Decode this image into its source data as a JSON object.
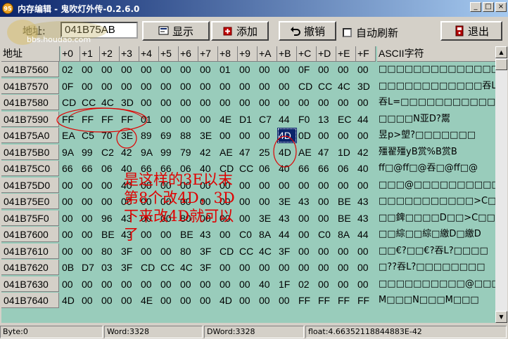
{
  "window": {
    "title": "内存编辑 - 鬼吹灯外传-0.2.6.0",
    "app_icon_text": "95",
    "minimize": "_",
    "maximize": "□",
    "close": "×"
  },
  "toolbar": {
    "address_label": "地址:",
    "address_value": "041B75AB",
    "watermark": "bbs.houdao.com",
    "show_label": "显示",
    "add_label": "添加",
    "undo_label": "撤销",
    "auto_refresh_label": "自动刷新",
    "auto_refresh_checked": false,
    "exit_label": "退出"
  },
  "grid": {
    "headers": [
      "地址",
      "+0",
      "+1",
      "+2",
      "+3",
      "+4",
      "+5",
      "+6",
      "+7",
      "+8",
      "+9",
      "+A",
      "+B",
      "+C",
      "+D",
      "+E",
      "+F",
      "ASCII字符"
    ],
    "rows": [
      {
        "addr": "041B7560",
        "bytes": [
          "02",
          "00",
          "00",
          "00",
          "00",
          "00",
          "00",
          "00",
          "01",
          "00",
          "00",
          "00",
          "0F",
          "00",
          "00",
          "00"
        ],
        "ascii": "□□□□□□□□□□□□□□□□"
      },
      {
        "addr": "041B7570",
        "bytes": [
          "0F",
          "00",
          "00",
          "00",
          "00",
          "00",
          "00",
          "00",
          "00",
          "00",
          "00",
          "00",
          "CD",
          "CC",
          "4C",
          "3D"
        ],
        "ascii": "□□□□□□□□□□□□吞L="
      },
      {
        "addr": "041B7580",
        "bytes": [
          "CD",
          "CC",
          "4C",
          "3D",
          "00",
          "00",
          "00",
          "00",
          "00",
          "00",
          "00",
          "00",
          "00",
          "00",
          "00",
          "00"
        ],
        "ascii": "吞L=□□□□□□□□□□□□"
      },
      {
        "addr": "041B7590",
        "bytes": [
          "FF",
          "FF",
          "FF",
          "FF",
          "01",
          "00",
          "00",
          "00",
          "4E",
          "D1",
          "C7",
          "44",
          "F0",
          "13",
          "EC",
          "44"
        ],
        "ascii": "□□□□N亚D?鬻"
      },
      {
        "addr": "041B75A0",
        "bytes": [
          "EA",
          "C5",
          "70",
          "3E",
          "89",
          "69",
          "88",
          "3E",
          "00",
          "00",
          "00",
          "4D",
          "0D",
          "00",
          "00",
          "00"
        ],
        "ascii": "昱p>塱?□□□□□□□"
      },
      {
        "addr": "041B75B0",
        "bytes": [
          "9A",
          "99",
          "C2",
          "42",
          "9A",
          "99",
          "79",
          "42",
          "AE",
          "47",
          "25",
          "4D",
          "AE",
          "47",
          "1D",
          "42"
        ],
        "ascii": "殭翟殭yB赏%B赏B"
      },
      {
        "addr": "041B75C0",
        "bytes": [
          "66",
          "66",
          "06",
          "40",
          "66",
          "66",
          "06",
          "40",
          "CD",
          "CC",
          "06",
          "40",
          "66",
          "66",
          "06",
          "40"
        ],
        "ascii": "ff□@ff□@吞□@ff□@"
      },
      {
        "addr": "041B75D0",
        "bytes": [
          "00",
          "00",
          "00",
          "40",
          "00",
          "00",
          "00",
          "00",
          "00",
          "00",
          "00",
          "00",
          "00",
          "00",
          "00",
          "00"
        ],
        "ascii": "□□□@□□□□□□□□□□□□"
      },
      {
        "addr": "041B75E0",
        "bytes": [
          "00",
          "00",
          "00",
          "00",
          "00",
          "00",
          "00",
          "00",
          "00",
          "00",
          "00",
          "3E",
          "43",
          "00",
          "BE",
          "43"
        ],
        "ascii": "□□□□□□□□□□□>C□□綜"
      },
      {
        "addr": "041B75F0",
        "bytes": [
          "00",
          "00",
          "96",
          "43",
          "00",
          "00",
          "80",
          "00",
          "00",
          "00",
          "3E",
          "43",
          "00",
          "00",
          "BE",
          "43"
        ],
        "ascii": "□□錍□□□□D□□>C□□綜"
      },
      {
        "addr": "041B7600",
        "bytes": [
          "00",
          "00",
          "BE",
          "43",
          "00",
          "00",
          "BE",
          "43",
          "00",
          "C0",
          "8A",
          "44",
          "00",
          "C0",
          "8A",
          "44"
        ],
        "ascii": "□□綜□□綜□繳D□繳D"
      },
      {
        "addr": "041B7610",
        "bytes": [
          "00",
          "00",
          "80",
          "3F",
          "00",
          "00",
          "80",
          "3F",
          "CD",
          "CC",
          "4C",
          "3F",
          "00",
          "00",
          "00",
          "00"
        ],
        "ascii": "□□€?□□€?吞L?□□□□"
      },
      {
        "addr": "041B7620",
        "bytes": [
          "0B",
          "D7",
          "03",
          "3F",
          "CD",
          "CC",
          "4C",
          "3F",
          "00",
          "00",
          "00",
          "00",
          "00",
          "00",
          "00",
          "00"
        ],
        "ascii": "□??吞L?□□□□□□□□"
      },
      {
        "addr": "041B7630",
        "bytes": [
          "00",
          "00",
          "00",
          "00",
          "00",
          "00",
          "00",
          "00",
          "00",
          "00",
          "40",
          "1F",
          "02",
          "00",
          "00",
          "00"
        ],
        "ascii": "□□□□□□□□□□@□□□□□"
      },
      {
        "addr": "041B7640",
        "bytes": [
          "4D",
          "00",
          "00",
          "00",
          "4E",
          "00",
          "00",
          "00",
          "4D",
          "00",
          "00",
          "00",
          "FF",
          "FF",
          "FF",
          "FF"
        ],
        "ascii": "M□□□N□□□M□□□"
      }
    ]
  },
  "annotation": {
    "line1": "是这样的3E以末",
    "line2": "第8个改4D，3D",
    "line3": "下来改4D就可以",
    "line4": "了",
    "color": "#e00000"
  },
  "status": {
    "byte": "Byte:0",
    "word": "Word:3328",
    "dword": "DWord:3328",
    "float": "float:4.66352118844883E-42"
  }
}
